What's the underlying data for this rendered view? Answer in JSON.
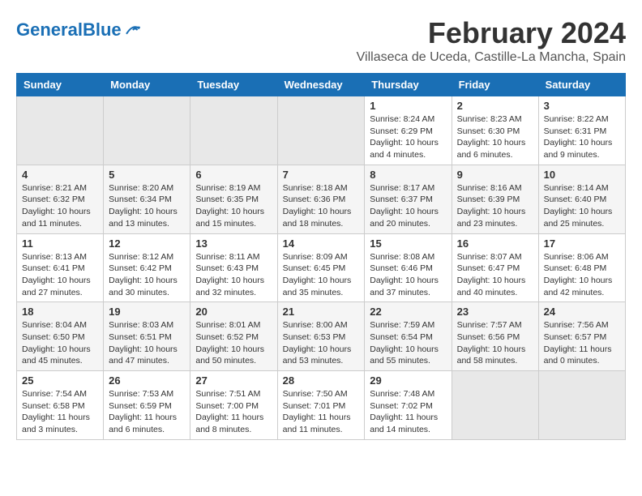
{
  "header": {
    "logo_general": "General",
    "logo_blue": "Blue",
    "title": "February 2024",
    "location": "Villaseca de Uceda, Castille-La Mancha, Spain"
  },
  "days_of_week": [
    "Sunday",
    "Monday",
    "Tuesday",
    "Wednesday",
    "Thursday",
    "Friday",
    "Saturday"
  ],
  "weeks": [
    [
      {
        "day": "",
        "info": ""
      },
      {
        "day": "",
        "info": ""
      },
      {
        "day": "",
        "info": ""
      },
      {
        "day": "",
        "info": ""
      },
      {
        "day": "1",
        "info": "Sunrise: 8:24 AM\nSunset: 6:29 PM\nDaylight: 10 hours\nand 4 minutes."
      },
      {
        "day": "2",
        "info": "Sunrise: 8:23 AM\nSunset: 6:30 PM\nDaylight: 10 hours\nand 6 minutes."
      },
      {
        "day": "3",
        "info": "Sunrise: 8:22 AM\nSunset: 6:31 PM\nDaylight: 10 hours\nand 9 minutes."
      }
    ],
    [
      {
        "day": "4",
        "info": "Sunrise: 8:21 AM\nSunset: 6:32 PM\nDaylight: 10 hours\nand 11 minutes."
      },
      {
        "day": "5",
        "info": "Sunrise: 8:20 AM\nSunset: 6:34 PM\nDaylight: 10 hours\nand 13 minutes."
      },
      {
        "day": "6",
        "info": "Sunrise: 8:19 AM\nSunset: 6:35 PM\nDaylight: 10 hours\nand 15 minutes."
      },
      {
        "day": "7",
        "info": "Sunrise: 8:18 AM\nSunset: 6:36 PM\nDaylight: 10 hours\nand 18 minutes."
      },
      {
        "day": "8",
        "info": "Sunrise: 8:17 AM\nSunset: 6:37 PM\nDaylight: 10 hours\nand 20 minutes."
      },
      {
        "day": "9",
        "info": "Sunrise: 8:16 AM\nSunset: 6:39 PM\nDaylight: 10 hours\nand 23 minutes."
      },
      {
        "day": "10",
        "info": "Sunrise: 8:14 AM\nSunset: 6:40 PM\nDaylight: 10 hours\nand 25 minutes."
      }
    ],
    [
      {
        "day": "11",
        "info": "Sunrise: 8:13 AM\nSunset: 6:41 PM\nDaylight: 10 hours\nand 27 minutes."
      },
      {
        "day": "12",
        "info": "Sunrise: 8:12 AM\nSunset: 6:42 PM\nDaylight: 10 hours\nand 30 minutes."
      },
      {
        "day": "13",
        "info": "Sunrise: 8:11 AM\nSunset: 6:43 PM\nDaylight: 10 hours\nand 32 minutes."
      },
      {
        "day": "14",
        "info": "Sunrise: 8:09 AM\nSunset: 6:45 PM\nDaylight: 10 hours\nand 35 minutes."
      },
      {
        "day": "15",
        "info": "Sunrise: 8:08 AM\nSunset: 6:46 PM\nDaylight: 10 hours\nand 37 minutes."
      },
      {
        "day": "16",
        "info": "Sunrise: 8:07 AM\nSunset: 6:47 PM\nDaylight: 10 hours\nand 40 minutes."
      },
      {
        "day": "17",
        "info": "Sunrise: 8:06 AM\nSunset: 6:48 PM\nDaylight: 10 hours\nand 42 minutes."
      }
    ],
    [
      {
        "day": "18",
        "info": "Sunrise: 8:04 AM\nSunset: 6:50 PM\nDaylight: 10 hours\nand 45 minutes."
      },
      {
        "day": "19",
        "info": "Sunrise: 8:03 AM\nSunset: 6:51 PM\nDaylight: 10 hours\nand 47 minutes."
      },
      {
        "day": "20",
        "info": "Sunrise: 8:01 AM\nSunset: 6:52 PM\nDaylight: 10 hours\nand 50 minutes."
      },
      {
        "day": "21",
        "info": "Sunrise: 8:00 AM\nSunset: 6:53 PM\nDaylight: 10 hours\nand 53 minutes."
      },
      {
        "day": "22",
        "info": "Sunrise: 7:59 AM\nSunset: 6:54 PM\nDaylight: 10 hours\nand 55 minutes."
      },
      {
        "day": "23",
        "info": "Sunrise: 7:57 AM\nSunset: 6:56 PM\nDaylight: 10 hours\nand 58 minutes."
      },
      {
        "day": "24",
        "info": "Sunrise: 7:56 AM\nSunset: 6:57 PM\nDaylight: 11 hours\nand 0 minutes."
      }
    ],
    [
      {
        "day": "25",
        "info": "Sunrise: 7:54 AM\nSunset: 6:58 PM\nDaylight: 11 hours\nand 3 minutes."
      },
      {
        "day": "26",
        "info": "Sunrise: 7:53 AM\nSunset: 6:59 PM\nDaylight: 11 hours\nand 6 minutes."
      },
      {
        "day": "27",
        "info": "Sunrise: 7:51 AM\nSunset: 7:00 PM\nDaylight: 11 hours\nand 8 minutes."
      },
      {
        "day": "28",
        "info": "Sunrise: 7:50 AM\nSunset: 7:01 PM\nDaylight: 11 hours\nand 11 minutes."
      },
      {
        "day": "29",
        "info": "Sunrise: 7:48 AM\nSunset: 7:02 PM\nDaylight: 11 hours\nand 14 minutes."
      },
      {
        "day": "",
        "info": ""
      },
      {
        "day": "",
        "info": ""
      }
    ]
  ]
}
